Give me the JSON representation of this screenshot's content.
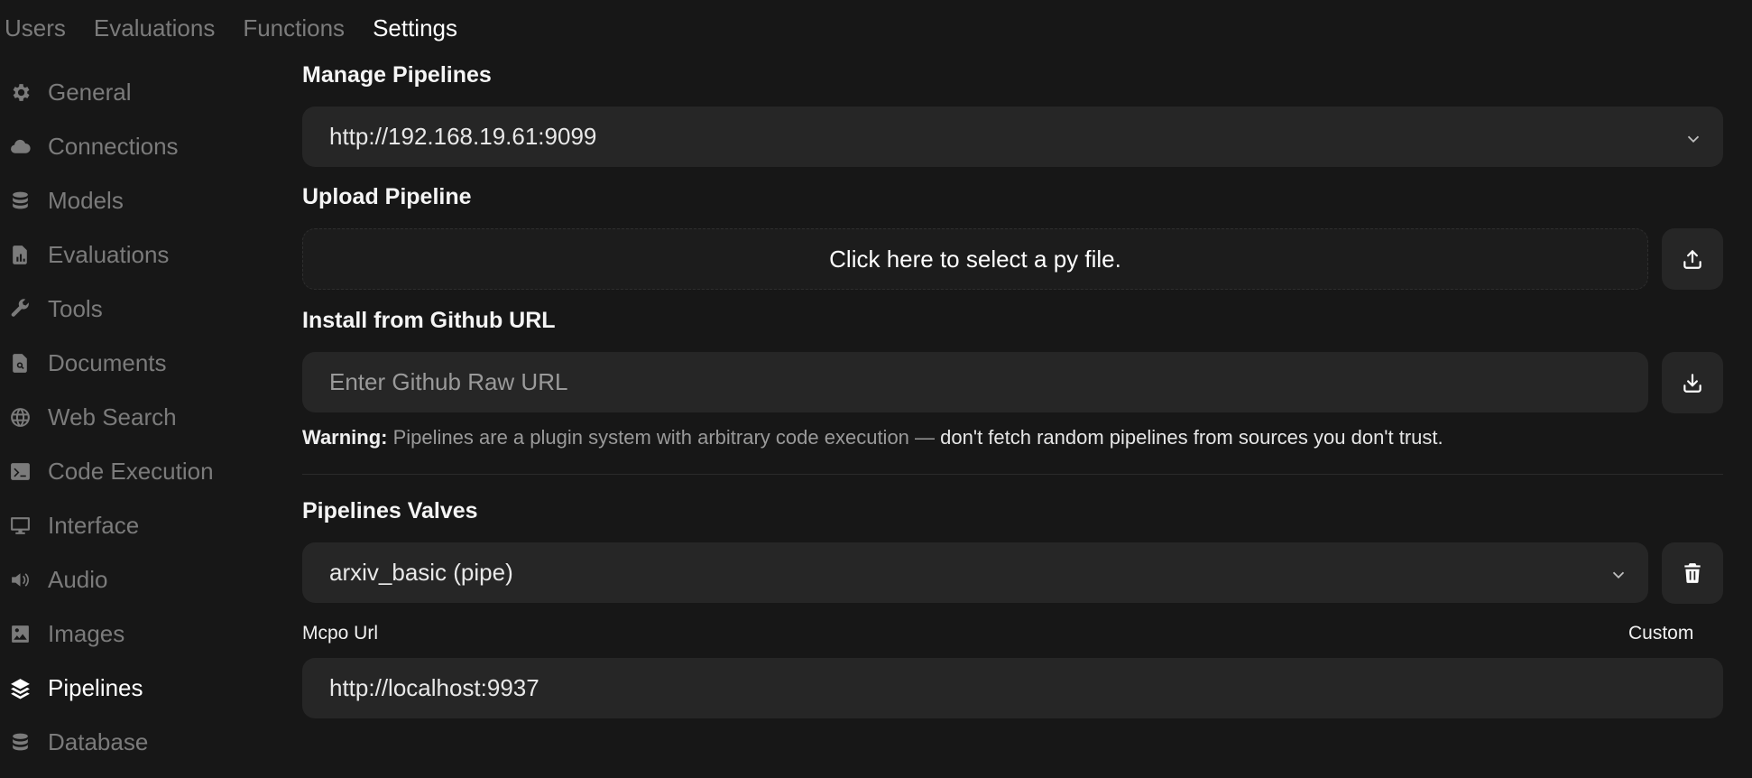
{
  "topnav": {
    "tabs": [
      "Users",
      "Evaluations",
      "Functions",
      "Settings"
    ],
    "active_tab": "Settings"
  },
  "sidebar": {
    "items": [
      {
        "label": "General",
        "icon": "gear-icon"
      },
      {
        "label": "Connections",
        "icon": "cloud-icon"
      },
      {
        "label": "Models",
        "icon": "database-icon"
      },
      {
        "label": "Evaluations",
        "icon": "document-chart-icon"
      },
      {
        "label": "Tools",
        "icon": "wrench-icon"
      },
      {
        "label": "Documents",
        "icon": "document-search-icon"
      },
      {
        "label": "Web Search",
        "icon": "globe-icon"
      },
      {
        "label": "Code Execution",
        "icon": "terminal-icon"
      },
      {
        "label": "Interface",
        "icon": "monitor-icon"
      },
      {
        "label": "Audio",
        "icon": "speaker-icon"
      },
      {
        "label": "Images",
        "icon": "image-icon"
      },
      {
        "label": "Pipelines",
        "icon": "layers-icon"
      },
      {
        "label": "Database",
        "icon": "database-icon"
      }
    ],
    "active_item": "Pipelines"
  },
  "manage": {
    "title": "Manage Pipelines",
    "selected_url": "http://192.168.19.61:9099"
  },
  "upload": {
    "title": "Upload Pipeline",
    "dropzone_text": "Click here to select a py file."
  },
  "github": {
    "title": "Install from Github URL",
    "placeholder": "Enter Github Raw URL"
  },
  "warning": {
    "label": "Warning:",
    "text": "Pipelines are a plugin system with arbitrary code execution —",
    "emphasis": "don't fetch random pipelines from sources you don't trust."
  },
  "valves": {
    "title": "Pipelines Valves",
    "selected_pipeline": "arxiv_basic (pipe)",
    "mcpo_label": "Mcpo Url",
    "custom_label": "Custom",
    "mcpo_value": "http://localhost:9937"
  },
  "colors": {
    "background": "#171717",
    "field": "#262626",
    "muted_text": "#7b7b7b",
    "active_text": "#ffffff"
  }
}
